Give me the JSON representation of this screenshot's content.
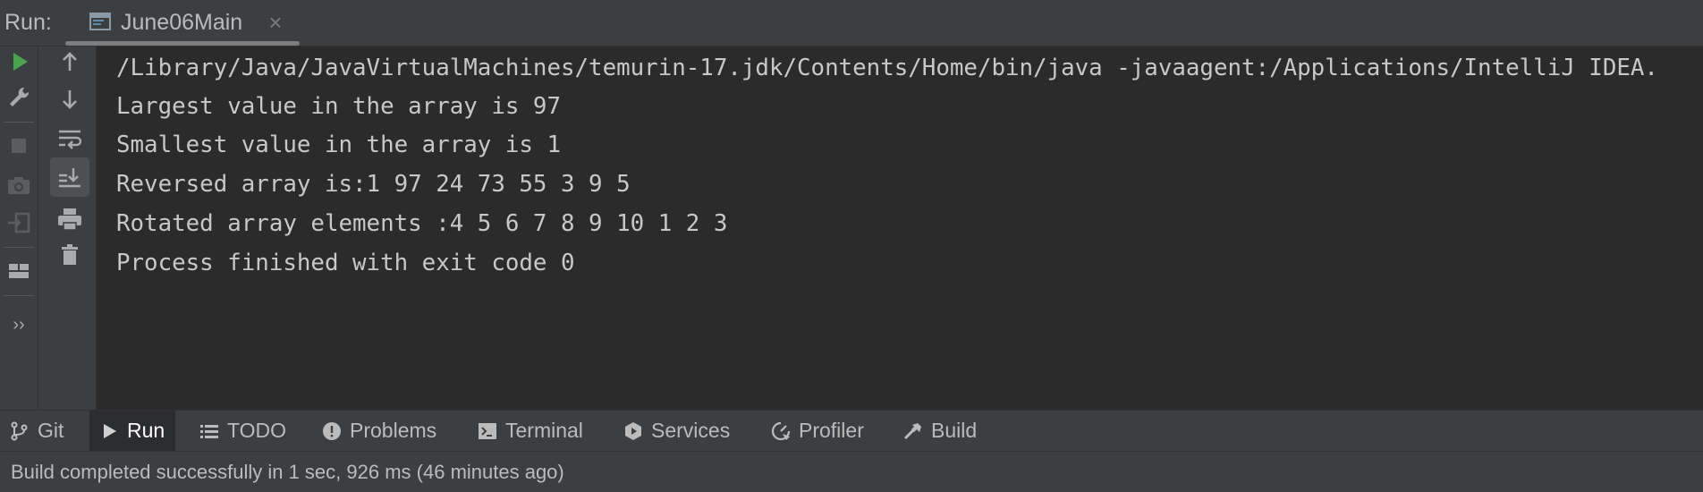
{
  "header": {
    "run_label": "Run:",
    "tab": {
      "label": "June06Main",
      "icon": "console-window-icon",
      "close_glyph": "×"
    }
  },
  "left_toolbar": [
    {
      "name": "rerun-icon",
      "color": "#4aa34f"
    },
    {
      "name": "wrench-icon"
    },
    {
      "name": "stop-icon"
    },
    {
      "name": "camera-icon"
    },
    {
      "name": "exit-icon"
    },
    {
      "name": "layout-icon"
    },
    {
      "name": "more-icon",
      "glyph": "››"
    }
  ],
  "console_toolbar": [
    {
      "name": "scroll-up-icon"
    },
    {
      "name": "scroll-down-icon"
    },
    {
      "name": "soft-wrap-icon"
    },
    {
      "name": "scroll-to-end-icon",
      "active": true
    },
    {
      "name": "print-icon"
    },
    {
      "name": "trash-icon"
    }
  ],
  "console": {
    "lines": [
      "/Library/Java/JavaVirtualMachines/temurin-17.jdk/Contents/Home/bin/java -javaagent:/Applications/IntelliJ IDEA.",
      "Largest value in the array is 97",
      "Smallest value in the array is 1",
      "Reversed array is:1 97 24 73 55 3 9 5",
      "Rotated array elements :4 5 6 7 8 9 10 1 2 3",
      "Process finished with exit code 0"
    ]
  },
  "tool_windows": [
    {
      "label": "Git",
      "icon": "git-branch-icon"
    },
    {
      "label": "Run",
      "icon": "run-icon",
      "active": true
    },
    {
      "label": "TODO",
      "icon": "list-icon"
    },
    {
      "label": "Problems",
      "icon": "problems-icon"
    },
    {
      "label": "Terminal",
      "icon": "terminal-icon"
    },
    {
      "label": "Services",
      "icon": "services-icon"
    },
    {
      "label": "Profiler",
      "icon": "profiler-icon"
    },
    {
      "label": "Build",
      "icon": "hammer-icon"
    }
  ],
  "status": {
    "text": "Build completed successfully in 1 sec, 926 ms (46 minutes ago)"
  },
  "colors": {
    "panel": "#3c3f41",
    "editor": "#2b2b2b",
    "text": "#bbbbbb",
    "console_text": "#c8c8c8",
    "run_green": "#4aa34f"
  }
}
